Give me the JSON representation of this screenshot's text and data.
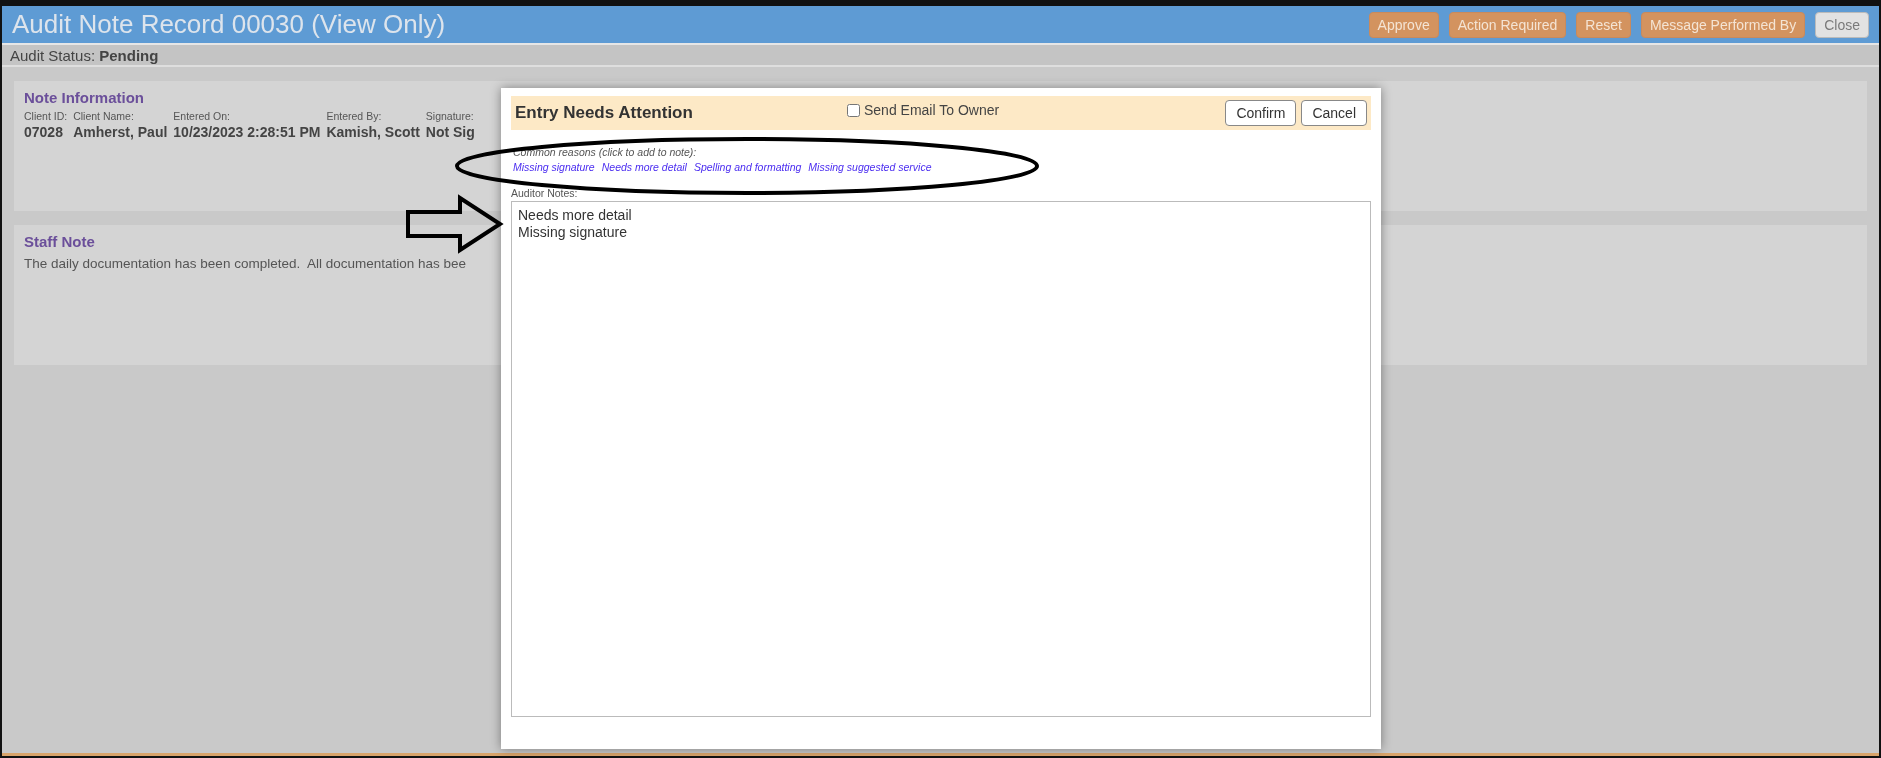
{
  "window": {
    "title": "Audit Note Record 00030 (View Only)"
  },
  "header_buttons": [
    {
      "label": "Approve",
      "kind": "action"
    },
    {
      "label": "Action Required",
      "kind": "action"
    },
    {
      "label": "Reset",
      "kind": "action"
    },
    {
      "label": "Message Performed By",
      "kind": "action"
    },
    {
      "label": "Close",
      "kind": "neutral"
    }
  ],
  "audit_status": {
    "label": "Audit Status:",
    "value": "Pending"
  },
  "note_information": {
    "title": "Note Information",
    "fields": [
      {
        "label": "Client ID:",
        "value": "07028"
      },
      {
        "label": "Client Name:",
        "value": "Amherst, Paul"
      },
      {
        "label": "Entered On:",
        "value": "10/23/2023 2:28:51 PM"
      },
      {
        "label": "Entered By:",
        "value": "Kamish, Scott"
      },
      {
        "label": "Signature:",
        "value": "Not Sig"
      }
    ]
  },
  "staff_note": {
    "title": "Staff Note",
    "text": "The daily documentation has been completed.  All documentation has bee"
  },
  "dialog": {
    "title": "Entry Needs Attention",
    "send_email": {
      "label": "Send Email To Owner",
      "checked": false
    },
    "buttons": [
      "Confirm",
      "Cancel"
    ],
    "reasons_label": "Common reasons (click to add to note):",
    "reasons": [
      "Missing signature",
      "Needs more detail",
      "Spelling and formatting",
      "Missing suggested service"
    ],
    "notes_label": "Auditor Notes:",
    "notes": "Needs more detail\nMissing signature"
  }
}
